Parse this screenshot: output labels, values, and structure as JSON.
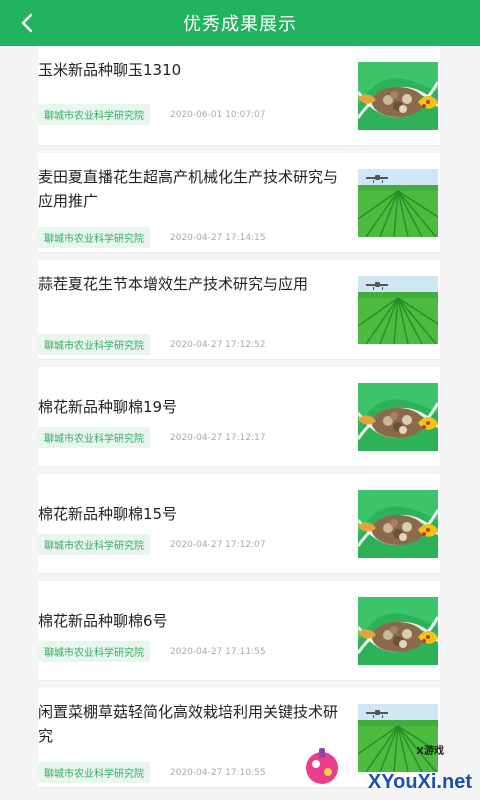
{
  "header": {
    "title": "优秀成果展示",
    "back_icon": "chevron-left-icon"
  },
  "colors": {
    "brand": "#21b35e",
    "tag_bg": "#e8f6ee",
    "tag_text": "#33aa66"
  },
  "items": [
    {
      "title": "玉米新品种聊玉1310",
      "org": "聊城市农业科学研究院",
      "date": "2020-06-01 10:07:07",
      "image": "seeds-collage"
    },
    {
      "title": "麦田夏直播花生超高产机械化生产技术研究与应用推广",
      "org": "聊城市农业科学研究院",
      "date": "2020-04-27 17:14:15",
      "image": "green-field-drone"
    },
    {
      "title": "蒜茬夏花生节本增效生产技术研究与应用",
      "org": "聊城市农业科学研究院",
      "date": "2020-04-27 17:12:52",
      "image": "green-field-drone"
    },
    {
      "title": "棉花新品种聊棉19号",
      "org": "聊城市农业科学研究院",
      "date": "2020-04-27 17:12:17",
      "image": "seeds-collage"
    },
    {
      "title": "棉花新品种聊棉15号",
      "org": "聊城市农业科学研究院",
      "date": "2020-04-27 17:12:07",
      "image": "seeds-collage"
    },
    {
      "title": "棉花新品种聊棉6号",
      "org": "聊城市农业科学研究院",
      "date": "2020-04-27 17:11:55",
      "image": "seeds-collage"
    },
    {
      "title": "闲置菜棚草菇轻简化高效栽培利用关键技术研究",
      "org": "聊城市农业科学研究院",
      "date": "2020-04-27 17:10:55",
      "image": "green-field-drone"
    }
  ],
  "watermark": {
    "main": "XYouXi.net",
    "sub": "X游戏"
  }
}
